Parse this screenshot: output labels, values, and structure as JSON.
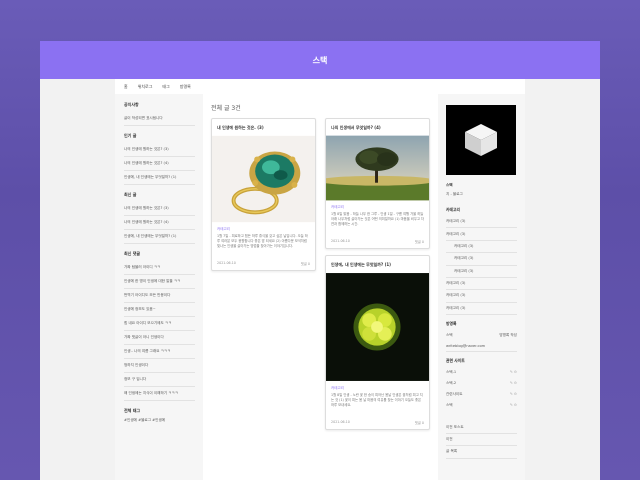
{
  "banner": {
    "title": "스택"
  },
  "nav": [
    "홈",
    "태그",
    "방명록"
  ],
  "nav_first": "위치로그",
  "left": {
    "recent_posts_title": "공지사항",
    "notice": "글이 작성되면 표시됩니다",
    "popular_title": "인기 글",
    "popular": [
      "나의 인생에 원하는 것은? (3)",
      "나의 인생에 원하는 것은? (4)",
      "인생에, 내 인생에는 무엇일까? (1)"
    ],
    "latest_title": "최신 글",
    "latest": [
      "나의 인생에 원하는 것은? (3)",
      "나의 인생에 원하는 것은? (4)",
      "인생에, 내 인생에는 무엇일까? (1)"
    ],
    "comments_title": "최신 댓글",
    "comments": [
      "가짜 텀블러 아이디 ㅋㅋ",
      "인생에 한 명이 인생에 대한 말을 ㅋㅋ",
      "번역기 아이디도 모든 반응이다",
      "인생에 정보도 있음~",
      "힘 내요 아이디 모으기에도 ㅋㅋ",
      "가짜 댓글이 아니 인생이다",
      "인생.. 나의 여름 그래요 ㅋㅋㅋ",
      "멍하지 인생이다",
      "정보 구 입니다",
      "왜 인생에는 지식이 이해하기 ㅋㅋㅋ"
    ],
    "tags_title": "전체 태그",
    "tags": "#인생에 #블로그 #인생에"
  },
  "center": {
    "header": "전체 글 3건",
    "cards": [
      {
        "title": "내 인생에 원하는 것은. (3)",
        "category": "카테고리",
        "summary": "1월 7일 - 피로하고 힘든 하루 휴식을 갖고 싶은 날입니다. 오늘 하루 여러분 모두 응원합니다 좋은 밤 되세요 (2) 아름다운 보석처럼 빛나는 인생을 살아가는 방법을 찾아가는 이야기입니다.",
        "date": "2021.06.10",
        "more": "댓글 0"
      },
      {
        "title": "나의 인생에서 무엇일까? (4)",
        "category": "카테고리",
        "summary": "1월 8일 맑음 - 하늘 나무 한 그루 - 인생 1일 - 구름 여행 가을 하늘 아래 나무처럼 살아가는 것은 어떤 의미일까요 (1) 마음을 비우고 자연과 함께하는 시간.",
        "date": "2021.06.10",
        "more": "댓글 0"
      },
      {
        "title": "인생에, 내 인생에는 무엇일까? (1)",
        "category": "카테고리",
        "summary": "1월 8일 인생 - 노란 꽃 한 송이 피어난 봄날 인생은 꽃처럼 피고 지는 것 (1) 꽃이 피는 봄 날 마음의 여유를 찾는 이야기 오늘도 좋은 하루 보내세요.",
        "date": "2021.06.10",
        "more": "댓글 0"
      }
    ]
  },
  "right": {
    "blog_name": "스택",
    "blog_sub": "지 - 블로그",
    "cat_title": "카테고리",
    "categories": [
      {
        "label": "카테고리 (3)",
        "sub": false
      },
      {
        "label": "카테고리 (3)",
        "sub": false
      },
      {
        "label": "카테고리 (3)",
        "sub": true
      },
      {
        "label": "카테고리 (3)",
        "sub": true
      },
      {
        "label": "카테고리 (3)",
        "sub": true
      },
      {
        "label": "카테고리 (3)",
        "sub": false
      },
      {
        "label": "카테고리 (3)",
        "sub": false
      },
      {
        "label": "카테고리 (3)",
        "sub": false
      }
    ],
    "contact_title": "방명록",
    "contact_name": "스택",
    "contact_val": "방명록 작성",
    "contact_mail": "writeblog@naver.com",
    "sns_title": "관련 사이트",
    "sns": [
      "스택-1",
      "스택-2",
      "관련사이트",
      "스택"
    ],
    "bottom": [
      "이전 포스트",
      "이전",
      "글 목록"
    ]
  }
}
